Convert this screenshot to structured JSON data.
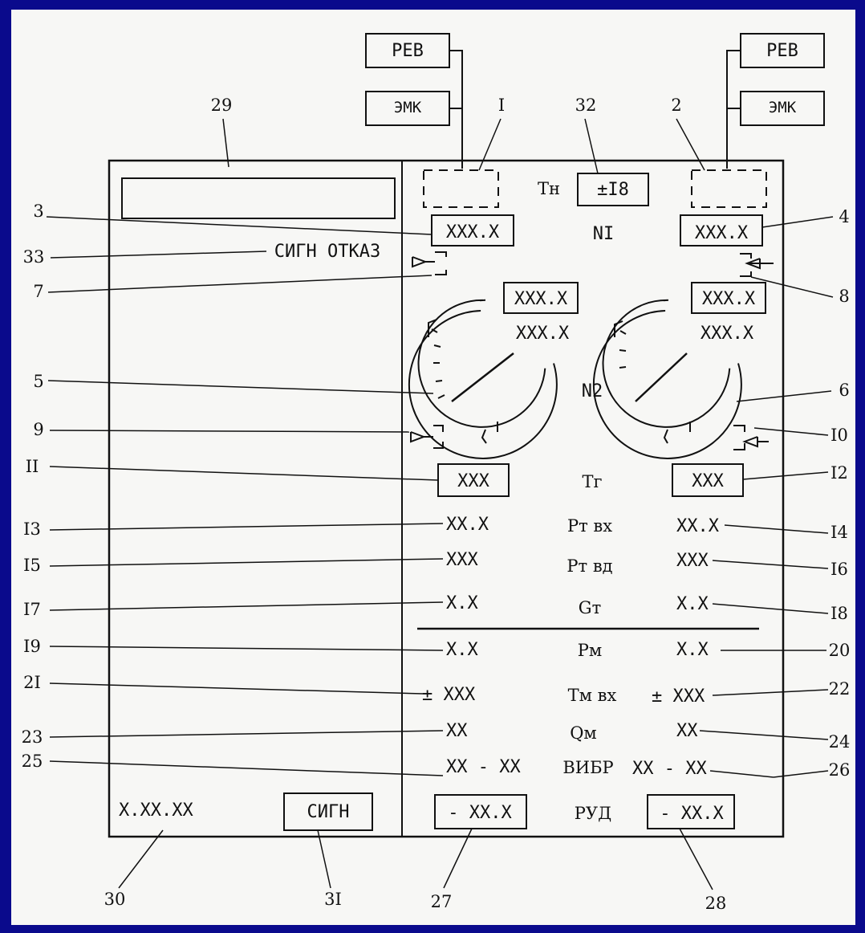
{
  "colors": {
    "background": "#0a0a8c",
    "paper": "#f7f7f5",
    "ink": "#111111"
  },
  "external_boxes": {
    "left": {
      "top": "РЕВ",
      "bottom": "ЭМК"
    },
    "right": {
      "top": "РЕВ",
      "bottom": "ЭМК"
    }
  },
  "left_panel": {
    "message": "СИГН ОТКАЗ",
    "time": "X.XX.XX",
    "button": "СИГН"
  },
  "right_panel": {
    "tn_label": "Тн",
    "tn_value": "±I8",
    "n1_label": "NI",
    "n1_left": "XXX.X",
    "n1_right": "XXX.X",
    "n2_label": "N2",
    "n2_left_boxed": "XXX.X",
    "n2_left": "XXX.X",
    "n2_right_boxed": "XXX.X",
    "n2_right": "XXX.X",
    "tg_label": "Тг",
    "tg_left": "XXX",
    "tg_right": "XXX",
    "rows": [
      {
        "label": "Рт вх",
        "left": "XX.X",
        "right": "XX.X"
      },
      {
        "label": "Рт вд",
        "left": "XXX",
        "right": "XXX"
      },
      {
        "label": "Gт",
        "left": "X.X",
        "right": "X.X"
      },
      {
        "label": "Рм",
        "left": "X.X",
        "right": "X.X"
      },
      {
        "label": "Тм вх",
        "left": "± XXX",
        "right": "± XXX"
      },
      {
        "label": "Qм",
        "left": "XX",
        "right": "XX"
      },
      {
        "label": "ВИБР",
        "left": "XX - XX",
        "right": "XX - XX"
      }
    ],
    "rud_label": "РУД",
    "rud_left": "- XX.X",
    "rud_right": "- XX.X"
  },
  "callouts": {
    "c29": "29",
    "cI": "I",
    "c32": "32",
    "c2": "2",
    "c3": "3",
    "c4": "4",
    "c33": "33",
    "c7": "7",
    "c8": "8",
    "c5": "5",
    "c6": "6",
    "c9": "9",
    "c10": "I0",
    "c11": "II",
    "c12": "I2",
    "c13": "I3",
    "c14": "I4",
    "c15": "I5",
    "c16": "I6",
    "c17": "I7",
    "c18": "I8",
    "c19": "I9",
    "c20": "20",
    "c21": "2I",
    "c22": "22",
    "c23": "23",
    "c24": "24",
    "c25": "25",
    "c26": "26",
    "c27": "27",
    "c28": "28",
    "c30": "30",
    "c31": "3I"
  }
}
